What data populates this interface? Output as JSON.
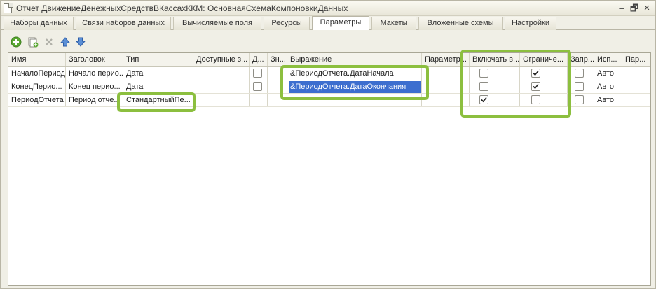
{
  "window": {
    "title": "Отчет ДвижениеДенежныхСредствВКассахККМ: ОсновнаяСхемаКомпоновкиДанных",
    "controls": {
      "minimize": "–",
      "restore": "🗗",
      "close": "×"
    }
  },
  "tabs": [
    "Наборы данных",
    "Связи наборов данных",
    "Вычисляемые поля",
    "Ресурсы",
    "Параметры",
    "Макеты",
    "Вложенные схемы",
    "Настройки"
  ],
  "active_tab": "Параметры",
  "toolbar": {
    "icons": [
      "add-icon",
      "copy-icon",
      "delete-icon",
      "move-up-icon",
      "move-down-icon"
    ]
  },
  "table": {
    "headers": [
      "Имя",
      "Заголовок",
      "Тип",
      "Доступные з...",
      "Д...",
      "Зн...",
      "Выражение",
      "Параметр...",
      "Включать в...",
      "Ограниче...",
      "Запр...",
      "Исп...",
      "Пар..."
    ],
    "rows": [
      {
        "name": "НачалоПериода",
        "name_display": "НачалоПериод...",
        "title": "Начало периода",
        "title_display": "Начало перио...",
        "type": "Дата",
        "available": "",
        "d_checked": false,
        "value": "",
        "expression": "&ПериодОтчета.ДатаНачала",
        "param": "",
        "include_checked": false,
        "restrict_checked": true,
        "forbid_checked": false,
        "use": "Авто",
        "par": ""
      },
      {
        "name": "КонецПериода",
        "name_display": "КонецПерио...",
        "title": "Конец периода",
        "title_display": "Конец перио...",
        "type": "Дата",
        "available": "",
        "d_checked": false,
        "value": "",
        "expression": "&ПериодОтчета.ДатаОкончания",
        "param": "",
        "include_checked": false,
        "restrict_checked": true,
        "forbid_checked": false,
        "use": "Авто",
        "par": ""
      },
      {
        "name": "ПериодОтчета",
        "name_display": "ПериодОтчета",
        "title": "Период отчета",
        "title_display": "Период отче...",
        "type": "СтандартныйПе...",
        "available": "",
        "d_checked": null,
        "value": "",
        "expression": "",
        "param": "",
        "include_checked": true,
        "restrict_checked": false,
        "forbid_checked": false,
        "use": "Авто",
        "par": ""
      }
    ],
    "selected_cell": "КонецПериода.expression"
  },
  "highlight_color": "#8cbf3f",
  "selection_color": "#3c6ecf"
}
